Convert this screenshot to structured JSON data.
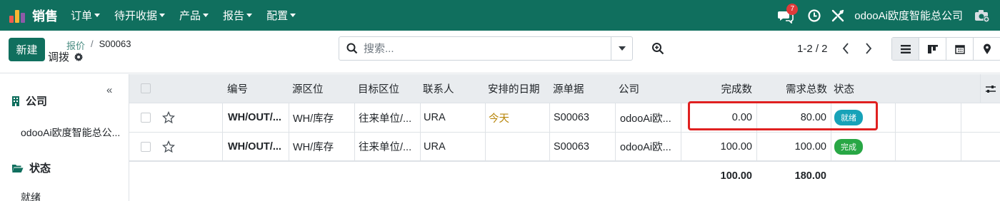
{
  "navbar": {
    "app_title": "销售",
    "menu": [
      {
        "label": "订单"
      },
      {
        "label": "待开收据"
      },
      {
        "label": "产品"
      },
      {
        "label": "报告"
      },
      {
        "label": "配置"
      }
    ],
    "chat_badge": "7",
    "company": "odooAi欧度智能总公司"
  },
  "control": {
    "new_label": "新建",
    "breadcrumb_parent": "报价",
    "breadcrumb_sep": "/",
    "breadcrumb_current": "S00063",
    "subtitle": "调拨",
    "search_placeholder": "搜索...",
    "pager": "1-2 / 2"
  },
  "sidebar": {
    "collapse_label": "«",
    "company_heading": "公司",
    "company_item": "odooAi欧度智能总公...",
    "status_heading": "状态",
    "status_item": "就绪"
  },
  "table": {
    "headers": {
      "ref": "编号",
      "src": "源区位",
      "dest": "目标区位",
      "contact": "联系人",
      "scheduled": "安排的日期",
      "origin": "源单据",
      "company": "公司",
      "done": "完成数",
      "demand": "需求总数",
      "state": "状态"
    },
    "rows": [
      {
        "ref": "WH/OUT/...",
        "src": "WH/库存",
        "dest": "往来单位/...",
        "contact": "URA",
        "scheduled": "今天",
        "origin": "S00063",
        "company": "odooAi欧...",
        "done": "0.00",
        "demand": "80.00",
        "state": "就绪",
        "state_color": "#17a2b8"
      },
      {
        "ref": "WH/OUT/...",
        "src": "WH/库存",
        "dest": "往来单位/...",
        "contact": "URA",
        "scheduled": "",
        "origin": "S00063",
        "company": "odooAi欧...",
        "done": "100.00",
        "demand": "100.00",
        "state": "完成",
        "state_color": "#28a745"
      }
    ],
    "totals": {
      "done": "100.00",
      "demand": "180.00"
    }
  },
  "colors": {
    "brand": "#106f5e",
    "highlight": "#e02020",
    "today": "#b8860b"
  }
}
